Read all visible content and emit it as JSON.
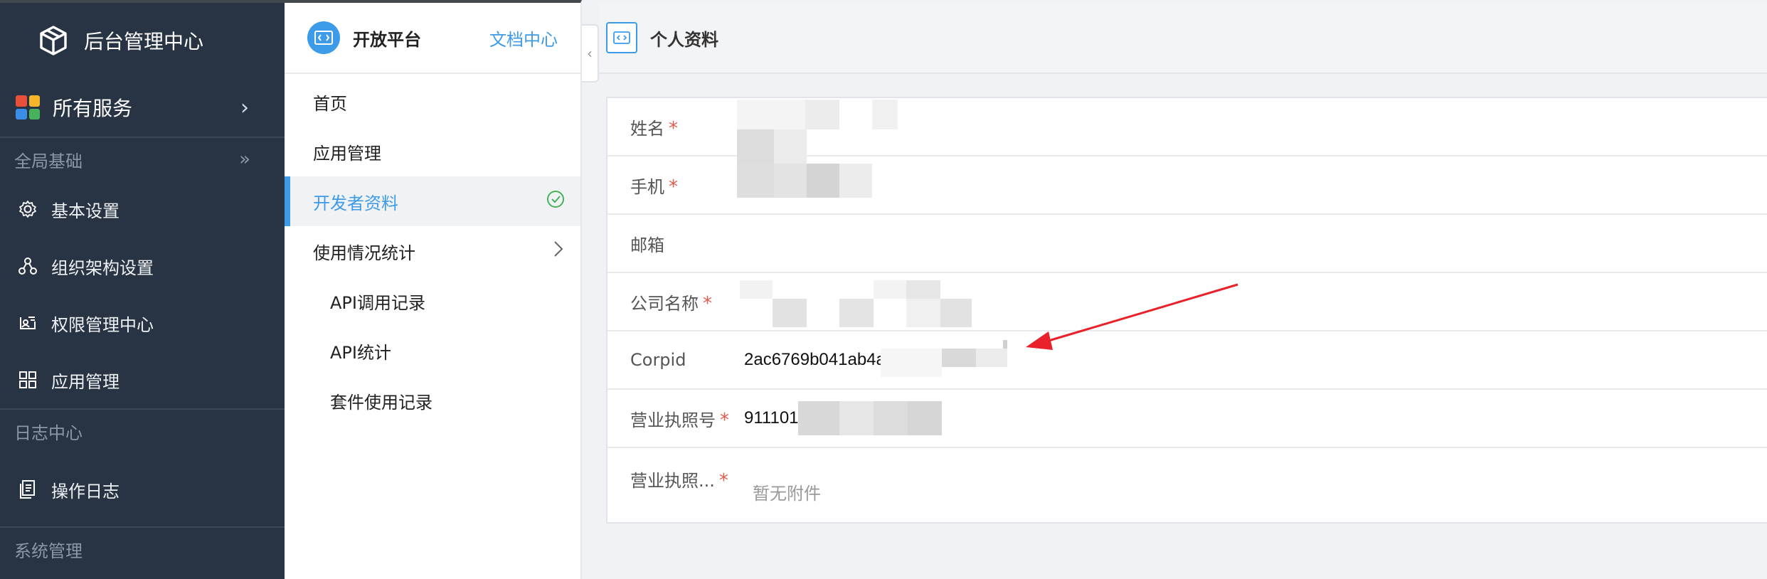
{
  "sidebar": {
    "brand": "后台管理中心",
    "all_services": "所有服务",
    "sections": [
      {
        "title": "全局基础",
        "items": [
          "基本设置",
          "组织架构设置",
          "权限管理中心",
          "应用管理"
        ]
      },
      {
        "title": "日志中心",
        "items": [
          "操作日志"
        ]
      },
      {
        "title": "系统管理",
        "items": []
      }
    ]
  },
  "panel": {
    "title": "开放平台",
    "doc_link": "文档中心",
    "items": [
      {
        "label": "首页"
      },
      {
        "label": "应用管理"
      },
      {
        "label": "开发者资料",
        "active": true
      },
      {
        "label": "使用情况统计"
      },
      {
        "label": "API调用记录"
      },
      {
        "label": "API统计"
      },
      {
        "label": "套件使用记录"
      }
    ]
  },
  "main": {
    "title": "个人资料",
    "fields": [
      {
        "label": "姓名",
        "required": true,
        "value": ""
      },
      {
        "label": "手机",
        "required": true,
        "value": ""
      },
      {
        "label": "邮箱",
        "required": false,
        "value": ""
      },
      {
        "label": "公司名称",
        "required": true,
        "value": ""
      },
      {
        "label": "Corpid",
        "required": false,
        "value": "2ac6769b041ab4a"
      },
      {
        "label": "营业执照号",
        "required": true,
        "value": "911101"
      },
      {
        "label": "营业执照...",
        "required": true,
        "value": "暂无附件"
      }
    ]
  },
  "colors": {
    "accent": "#3d9be9",
    "sidebar_bg": "#283443",
    "required": "#e25b4b",
    "arrow": "#e8212a"
  }
}
